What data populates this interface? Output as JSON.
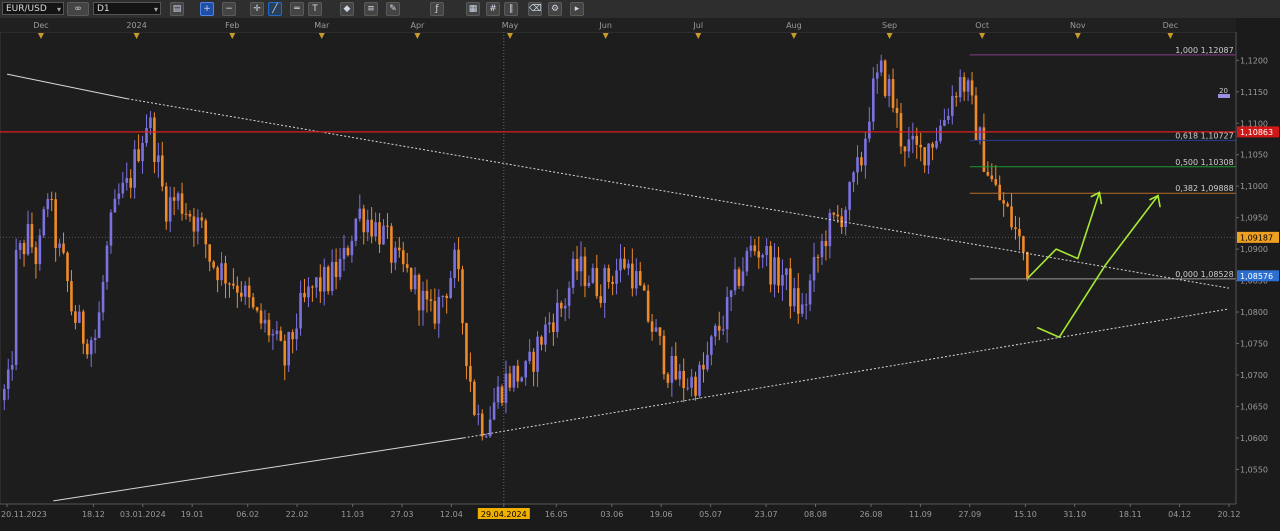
{
  "toolbar": {
    "symbol": "EUR/USD",
    "timeframe": "D1",
    "icons": [
      "chart-type-icon",
      "zoom-in-icon",
      "zoom-out-icon",
      "crosshair-icon",
      "trend-line-icon",
      "horizontal-line-icon",
      "text-icon",
      "objects-icon",
      "fibonacci-icon",
      "pencil-icon",
      "indicators-icon",
      "templates-icon",
      "grid-icon",
      "channel-icon",
      "eraser-icon",
      "settings-icon",
      "more-icon"
    ]
  },
  "colors": {
    "background": "#1b1b1b",
    "bull": "#7b72e0",
    "bear": "#ef8a2a",
    "red_line": "#e01e1e",
    "fib_100": "#8a3a8a",
    "fib_618": "#2a3a9a",
    "fib_500": "#1c9a2c",
    "fib_382": "#b56a2a",
    "fib_0": "#9a9a9a",
    "arrows": "#a6e832",
    "trend": "#d8d8d8"
  },
  "chart_data": {
    "type": "candlestick",
    "symbol": "EUR/USD",
    "timeframe": "D1",
    "ylim": [
      1.0495,
      1.1245
    ],
    "x_range": [
      "2023-11-20",
      "2024-12-20"
    ],
    "month_labels": [
      {
        "label": "Dec",
        "date": "2023-12-01"
      },
      {
        "label": "2024",
        "date": "2024-01-01"
      },
      {
        "label": "Feb",
        "date": "2024-02-01"
      },
      {
        "label": "Mar",
        "date": "2024-03-01"
      },
      {
        "label": "Apr",
        "date": "2024-04-01"
      },
      {
        "label": "May",
        "date": "2024-05-01"
      },
      {
        "label": "Jun",
        "date": "2024-06-01"
      },
      {
        "label": "Jul",
        "date": "2024-07-01"
      },
      {
        "label": "Aug",
        "date": "2024-08-01"
      },
      {
        "label": "Sep",
        "date": "2024-09-01"
      },
      {
        "label": "Oct",
        "date": "2024-10-01"
      },
      {
        "label": "Nov",
        "date": "2024-11-01"
      },
      {
        "label": "Dec",
        "date": "2024-12-01"
      }
    ],
    "x_ticks": [
      {
        "label": "20.11.2023",
        "date": "2023-11-20"
      },
      {
        "label": "18.12",
        "date": "2023-12-18"
      },
      {
        "label": "03.01.2024",
        "date": "2024-01-03"
      },
      {
        "label": "19.01",
        "date": "2024-01-19"
      },
      {
        "label": "06.02",
        "date": "2024-02-06"
      },
      {
        "label": "22.02",
        "date": "2024-02-22"
      },
      {
        "label": "11.03",
        "date": "2024-03-11"
      },
      {
        "label": "27.03",
        "date": "2024-03-27"
      },
      {
        "label": "12.04",
        "date": "2024-04-12"
      },
      {
        "label": "29.04.2024",
        "date": "2024-04-29",
        "highlight": true
      },
      {
        "label": "16.05",
        "date": "2024-05-16"
      },
      {
        "label": "03.06",
        "date": "2024-06-03"
      },
      {
        "label": "19.06",
        "date": "2024-06-19"
      },
      {
        "label": "05.07",
        "date": "2024-07-05"
      },
      {
        "label": "23.07",
        "date": "2024-07-23"
      },
      {
        "label": "08.08",
        "date": "2024-08-08"
      },
      {
        "label": "26.08",
        "date": "2024-08-26"
      },
      {
        "label": "11.09",
        "date": "2024-09-11"
      },
      {
        "label": "27.09",
        "date": "2024-09-27"
      },
      {
        "label": "15.10",
        "date": "2024-10-15"
      },
      {
        "label": "31.10",
        "date": "2024-10-31"
      },
      {
        "label": "18.11",
        "date": "2024-11-18"
      },
      {
        "label": "04.12",
        "date": "2024-12-04"
      },
      {
        "label": "20.12",
        "date": "2024-12-20"
      }
    ],
    "y_ticks": [
      "1,1200",
      "1,1150",
      "1,1100",
      "1,1050",
      "1,1000",
      "1,0950",
      "1,0900",
      "1,0850",
      "1,0800",
      "1,0750",
      "1,0700",
      "1,0650",
      "1,0600",
      "1,0550"
    ],
    "tick_values": [
      1.12,
      1.115,
      1.11,
      1.105,
      1.1,
      1.095,
      1.09,
      1.085,
      1.08,
      1.075,
      1.07,
      1.065,
      1.06,
      1.055
    ],
    "price_labels": [
      {
        "text": "1,10863",
        "value": 1.10863,
        "bg": "#d01818",
        "fg": "#ffffff"
      },
      {
        "text": "1,09187",
        "value": 1.09187,
        "bg": "#f0a020",
        "fg": "#000000"
      },
      {
        "text": "1,08576",
        "value": 1.08576,
        "bg": "#2c6fd0",
        "fg": "#ffffff"
      }
    ],
    "small_label": "20",
    "horizontal_line": {
      "value": 1.10863
    },
    "fibonacci": {
      "start_date": "2024-09-27",
      "end_date": "2024-12-17",
      "levels": [
        {
          "label": "1,000 1,12087",
          "value": 1.12087,
          "color": "#8a3a8a"
        },
        {
          "label": "0,618 1,10727",
          "value": 1.10727,
          "color": "#2a3a9a"
        },
        {
          "label": "0,500 1,10308",
          "value": 1.10308,
          "color": "#1c9a2c"
        },
        {
          "label": "0,382 1,09888",
          "value": 1.09888,
          "color": "#b56a2a"
        },
        {
          "label": "0,000 1,08528",
          "value": 1.08528,
          "color": "#9a9a9a"
        }
      ]
    },
    "trend_lines": [
      {
        "style": "solid",
        "from": {
          "date": "2023-11-20",
          "value": 1.1178
        },
        "to": {
          "date": "2023-12-29",
          "value": 1.1139
        }
      },
      {
        "style": "dotted",
        "from": {
          "date": "2023-12-29",
          "value": 1.1139
        },
        "to": {
          "date": "2024-12-20",
          "value": 1.0838
        }
      },
      {
        "style": "solid",
        "from": {
          "date": "2023-12-05",
          "value": 1.05
        },
        "to": {
          "date": "2024-04-16",
          "value": 1.06
        }
      },
      {
        "style": "dotted",
        "from": {
          "date": "2024-04-16",
          "value": 1.06
        },
        "to": {
          "date": "2024-12-20",
          "value": 1.0805
        }
      }
    ],
    "vertical_crosshair_date": "2024-04-29",
    "horizontal_crosshair_value": 1.09187,
    "projection_arrows": [
      [
        [
          "2024-10-16",
          1.0855
        ],
        [
          "2024-10-25",
          1.09
        ],
        [
          "2024-11-01",
          1.0885
        ],
        [
          "2024-11-08",
          1.099
        ]
      ],
      [
        [
          "2024-10-19",
          1.0775
        ],
        [
          "2024-10-26",
          1.076
        ],
        [
          "2024-11-10",
          1.0875
        ],
        [
          "2024-11-27",
          1.0985
        ]
      ]
    ],
    "candle_anchors": [
      [
        "2023-11-20",
        1.066
      ],
      [
        "2023-11-24",
        1.082
      ],
      [
        "2023-11-29",
        1.0935
      ],
      [
        "2023-12-01",
        1.09
      ],
      [
        "2023-12-06",
        1.089
      ],
      [
        "2023-12-08",
        1.091
      ],
      [
        "2023-12-12",
        1.0945
      ],
      [
        "2023-12-15",
        1.096
      ],
      [
        "2023-12-19",
        1.084
      ],
      [
        "2023-12-22",
        1.079
      ],
      [
        "2023-12-26",
        1.076
      ],
      [
        "2024-01-02",
        1.08
      ],
      [
        "2024-01-05",
        1.086
      ],
      [
        "2024-01-10",
        1.092
      ],
      [
        "2024-01-15",
        1.094
      ],
      [
        "2024-01-17",
        1.0965
      ],
      [
        "2024-01-22",
        1.102
      ],
      [
        "2024-01-25",
        1.102
      ],
      [
        "2024-01-29",
        1.109
      ],
      [
        "2024-02-01",
        1.1125
      ],
      [
        "2024-02-05",
        1.1045
      ],
      [
        "2024-02-08",
        1.0975
      ],
      [
        "2024-02-13",
        1.098
      ],
      [
        "2024-02-16",
        1.0975
      ],
      [
        "2024-02-20",
        1.096
      ],
      [
        "2024-02-23",
        1.092
      ],
      [
        "2024-02-26",
        1.089
      ],
      [
        "2024-03-01",
        1.088
      ],
      [
        "2024-03-05",
        1.087
      ],
      [
        "2024-03-08",
        1.086
      ],
      [
        "2024-03-11",
        1.083
      ],
      [
        "2024-03-14",
        1.08
      ],
      [
        "2024-03-19",
        1.076
      ],
      [
        "2024-03-22",
        1.074
      ],
      [
        "2024-03-26",
        1.079
      ],
      [
        "2024-03-29",
        1.081
      ],
      [
        "2024-04-03",
        1.084
      ],
      [
        "2024-04-08",
        1.086
      ],
      [
        "2024-04-11",
        1.084
      ],
      [
        "2024-04-16",
        1.087
      ],
      [
        "2024-04-19",
        1.096
      ],
      [
        "2024-04-24",
        1.094
      ],
      [
        "2024-04-29",
        1.092
      ],
      [
        "2024-05-03",
        1.086
      ],
      [
        "2024-05-08",
        1.079
      ],
      [
        "2024-05-13",
        1.076
      ],
      [
        "2024-05-16",
        1.077
      ],
      [
        "2024-05-21",
        1.079
      ],
      [
        "2024-05-24",
        1.086
      ],
      [
        "2024-05-29",
        1.088
      ],
      [
        "2024-06-03",
        1.088
      ],
      [
        "2024-06-06",
        1.086
      ],
      [
        "2024-06-11",
        1.084
      ],
      [
        "2024-06-14",
        1.082
      ],
      [
        "2024-06-18",
        1.086
      ],
      [
        "2024-06-21",
        1.088
      ],
      [
        "2024-06-26",
        1.091
      ],
      [
        "2024-07-01",
        1.085
      ],
      [
        "2024-07-05",
        1.076
      ],
      [
        "2024-07-10",
        1.067
      ],
      [
        "2024-07-15",
        1.062
      ],
      [
        "2024-07-18",
        1.063
      ],
      [
        "2024-07-23",
        1.067
      ],
      [
        "2024-07-26",
        1.066
      ],
      [
        "2024-07-31",
        1.07
      ],
      [
        "2024-08-05",
        1.071
      ],
      [
        "2024-08-08",
        1.068
      ],
      [
        "2024-08-13",
        1.07
      ],
      [
        "2024-08-16",
        1.072
      ],
      [
        "2024-08-21",
        1.074
      ],
      [
        "2024-08-26",
        1.078
      ],
      [
        "2024-08-30",
        1.086
      ],
      [
        "2024-09-04",
        1.087
      ],
      [
        "2024-09-09",
        1.0855
      ],
      [
        "2024-09-12",
        1.082
      ],
      [
        "2024-09-17",
        1.084
      ],
      [
        "2024-09-20",
        1.085
      ],
      [
        "2024-09-24",
        1.086
      ],
      [
        "2024-09-27",
        1.09
      ],
      [
        "2024-10-02",
        1.088
      ],
      [
        "2024-10-07",
        1.085
      ],
      [
        "2024-10-10",
        1.083
      ],
      [
        "2024-10-15",
        1.081
      ],
      [
        "2024-10-18",
        1.086
      ],
      [
        "2024-10-23",
        1.092
      ],
      [
        "2024-10-28",
        1.094
      ],
      [
        "2024-11-01",
        1.0935
      ],
      [
        "2024-11-06",
        1.1
      ],
      [
        "2024-11-11",
        1.105
      ],
      [
        "2024-11-15",
        1.11
      ],
      [
        "2024-11-20",
        1.116
      ],
      [
        "2024-11-25",
        1.119
      ],
      [
        "2024-11-29",
        1.112
      ],
      [
        "2024-12-04",
        1.106
      ],
      [
        "2024-12-09",
        1.108
      ],
      [
        "2024-12-12",
        1.109
      ],
      [
        "2024-12-17",
        1.108
      ]
    ]
  }
}
